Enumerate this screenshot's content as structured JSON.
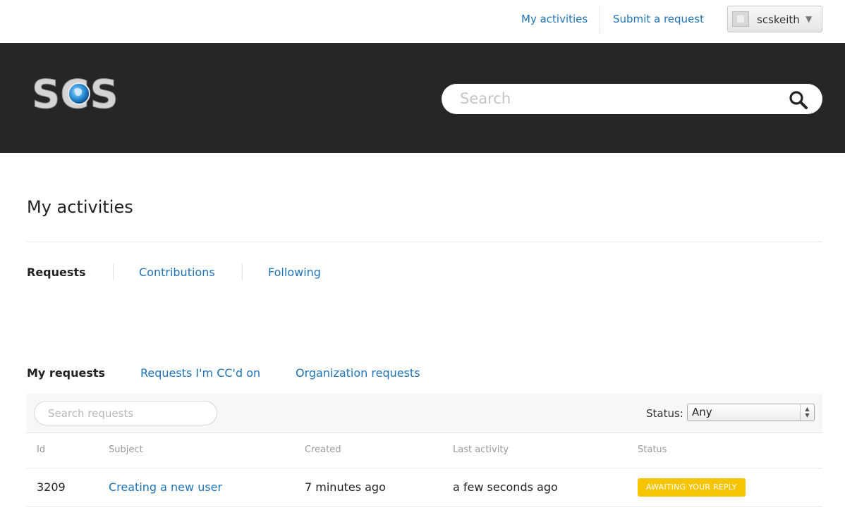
{
  "topbar": {
    "my_activities": "My activities",
    "submit_request": "Submit a request",
    "user_name": "scskeith"
  },
  "header": {
    "logo_text": "SCS",
    "search_placeholder": "Search"
  },
  "page": {
    "title": "My activities"
  },
  "activity_tabs": [
    {
      "label": "Requests",
      "active": true
    },
    {
      "label": "Contributions",
      "active": false
    },
    {
      "label": "Following",
      "active": false
    }
  ],
  "request_tabs": [
    {
      "label": "My requests",
      "active": true
    },
    {
      "label": "Requests I'm CC'd on",
      "active": false
    },
    {
      "label": "Organization requests",
      "active": false
    }
  ],
  "filter": {
    "search_placeholder": "Search requests",
    "status_label": "Status:",
    "status_value": "Any"
  },
  "table": {
    "headers": [
      "Id",
      "Subject",
      "Created",
      "Last activity",
      "Status"
    ],
    "rows": [
      {
        "id": "3209",
        "subject": "Creating a new user",
        "created": "7 minutes ago",
        "last_activity": "a few seconds ago",
        "status": "AWAITING YOUR REPLY"
      }
    ]
  },
  "colors": {
    "link": "#1f73b7",
    "header_bg": "#262626",
    "status_badge": "#f7c400"
  },
  "icons": {
    "search": "search-icon",
    "user_menu_caret": "caret-down-icon"
  }
}
